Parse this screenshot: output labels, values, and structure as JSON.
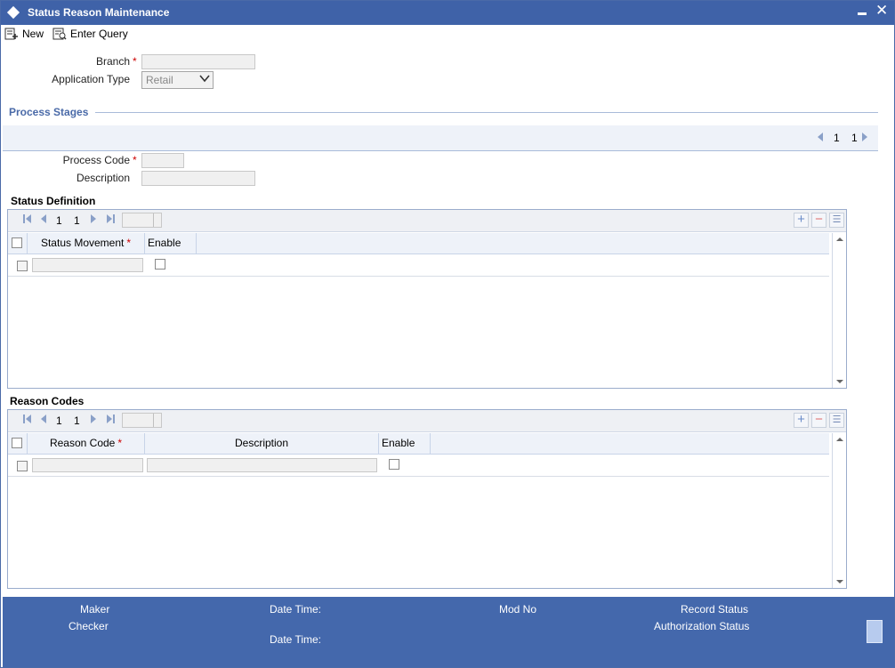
{
  "window": {
    "title": "Status Reason Maintenance"
  },
  "toolbar": {
    "new_label": "New",
    "enter_query_label": "Enter Query"
  },
  "form": {
    "branch_label": "Branch",
    "app_type_label": "Application Type",
    "app_type_value": "Retail",
    "process_code_label": "Process Code",
    "description_label": "Description"
  },
  "stages": {
    "title": "Process Stages",
    "page_current": "1",
    "page_total": "1"
  },
  "status_def": {
    "title": "Status Definition",
    "page_current": "1",
    "page_total": "1",
    "columns": [
      "Status Movement",
      "Enable"
    ]
  },
  "reason_codes": {
    "title": "Reason Codes",
    "page_current": "1",
    "page_total": "1",
    "columns": [
      "Reason Code",
      "Description",
      "Enable"
    ]
  },
  "footer": {
    "maker": "Maker",
    "checker": "Checker",
    "date_time": "Date Time:",
    "date_time2": "Date Time:",
    "mod_no": "Mod No",
    "record_status": "Record Status",
    "auth_status": "Authorization Status"
  },
  "colors": {
    "titlebar": "#3f62a8",
    "footer": "#4468ac",
    "section": "#4a6aa8",
    "required": "#cc0000"
  }
}
